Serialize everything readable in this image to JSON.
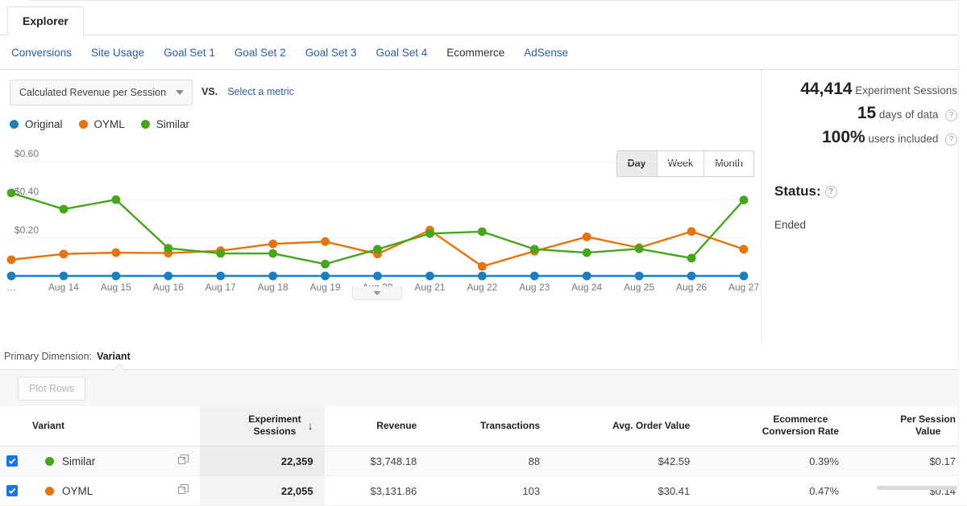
{
  "window": {
    "explorer_tab": "Explorer"
  },
  "subnav": {
    "items": [
      {
        "label": "Conversions",
        "active": false
      },
      {
        "label": "Site Usage",
        "active": false
      },
      {
        "label": "Goal Set 1",
        "active": false
      },
      {
        "label": "Goal Set 2",
        "active": false
      },
      {
        "label": "Goal Set 3",
        "active": false
      },
      {
        "label": "Goal Set 4",
        "active": false
      },
      {
        "label": "Ecommerce",
        "active": true
      },
      {
        "label": "AdSense",
        "active": false
      }
    ]
  },
  "controls": {
    "metric_selected": "Calculated Revenue per Session",
    "vs_label": "VS.",
    "select_metric_link": "Select a metric",
    "granularity": {
      "options": [
        "Day",
        "Week",
        "Month"
      ],
      "selected": "Day"
    },
    "collapse_icon": "chevron-down-icon"
  },
  "stats": {
    "sessions_value": "44,414",
    "sessions_label": "Experiment Sessions",
    "days_value": "15",
    "days_label": "days of data",
    "users_value": "100%",
    "users_label": "users included",
    "status_heading": "Status:",
    "status_value": "Ended",
    "help_glyph": "?"
  },
  "primary_dimension": {
    "label": "Primary Dimension:",
    "value": "Variant"
  },
  "plot_rows_button": "Plot Rows",
  "chart_data": {
    "type": "line",
    "title": "Calculated Revenue per Session",
    "xlabel": "",
    "ylabel": "Calculated Revenue per Session",
    "ylim": [
      0,
      0.7
    ],
    "yticks": [
      0.2,
      0.4,
      0.6
    ],
    "ytick_labels": [
      "$0.20",
      "$0.40",
      "$0.60"
    ],
    "grid": true,
    "legend_position": "top-left",
    "x": [
      "…",
      "Aug 14",
      "Aug 15",
      "Aug 16",
      "Aug 17",
      "Aug 18",
      "Aug 19",
      "Aug 20",
      "Aug 21",
      "Aug 22",
      "Aug 23",
      "Aug 24",
      "Aug 25",
      "Aug 26",
      "Aug 27"
    ],
    "series": [
      {
        "name": "Original",
        "color": "#1a7fc1",
        "values": [
          0.0,
          0.0,
          0.0,
          0.0,
          0.0,
          0.0,
          0.0,
          0.0,
          0.0,
          0.0,
          0.0,
          0.0,
          0.0,
          0.0,
          0.0
        ]
      },
      {
        "name": "OYML",
        "color": "#e8730c",
        "values": [
          0.085,
          0.115,
          0.122,
          0.12,
          0.132,
          0.168,
          0.18,
          0.115,
          0.24,
          0.05,
          0.13,
          0.205,
          0.148,
          0.233,
          0.14
        ]
      },
      {
        "name": "Similar",
        "color": "#43a718",
        "values": [
          0.435,
          0.35,
          0.4,
          0.145,
          0.118,
          0.118,
          0.062,
          0.14,
          0.222,
          0.232,
          0.14,
          0.122,
          0.142,
          0.093,
          0.398
        ]
      }
    ]
  },
  "table": {
    "columns": [
      {
        "label": "Variant",
        "type": "text",
        "align": "left"
      },
      {
        "label": "Experiment Sessions",
        "type": "number",
        "align": "right",
        "sorted": true,
        "sort_direction": "desc",
        "sort_icon": "arrow-down-icon"
      },
      {
        "label": "Revenue",
        "type": "number",
        "align": "right"
      },
      {
        "label": "Transactions",
        "type": "number",
        "align": "right"
      },
      {
        "label": "Avg. Order Value",
        "type": "number",
        "align": "right"
      },
      {
        "label": "Ecommerce Conversion Rate",
        "type": "number",
        "align": "right"
      },
      {
        "label": "Per Session Value",
        "type": "number",
        "align": "right"
      }
    ],
    "rows": [
      {
        "checked": true,
        "dot_color": "#43a718",
        "variant": "Similar",
        "experiment_sessions": "22,359",
        "revenue": "$3,748.18",
        "transactions": "88",
        "avg_order_value": "$42.59",
        "ecommerce_conversion_rate": "0.39%",
        "per_session_value": "$0.17"
      },
      {
        "checked": true,
        "dot_color": "#e8730c",
        "variant": "OYML",
        "experiment_sessions": "22,055",
        "revenue": "$3,131.86",
        "transactions": "103",
        "avg_order_value": "$30.41",
        "ecommerce_conversion_rate": "0.47%",
        "per_session_value": "$0.14"
      }
    ]
  }
}
